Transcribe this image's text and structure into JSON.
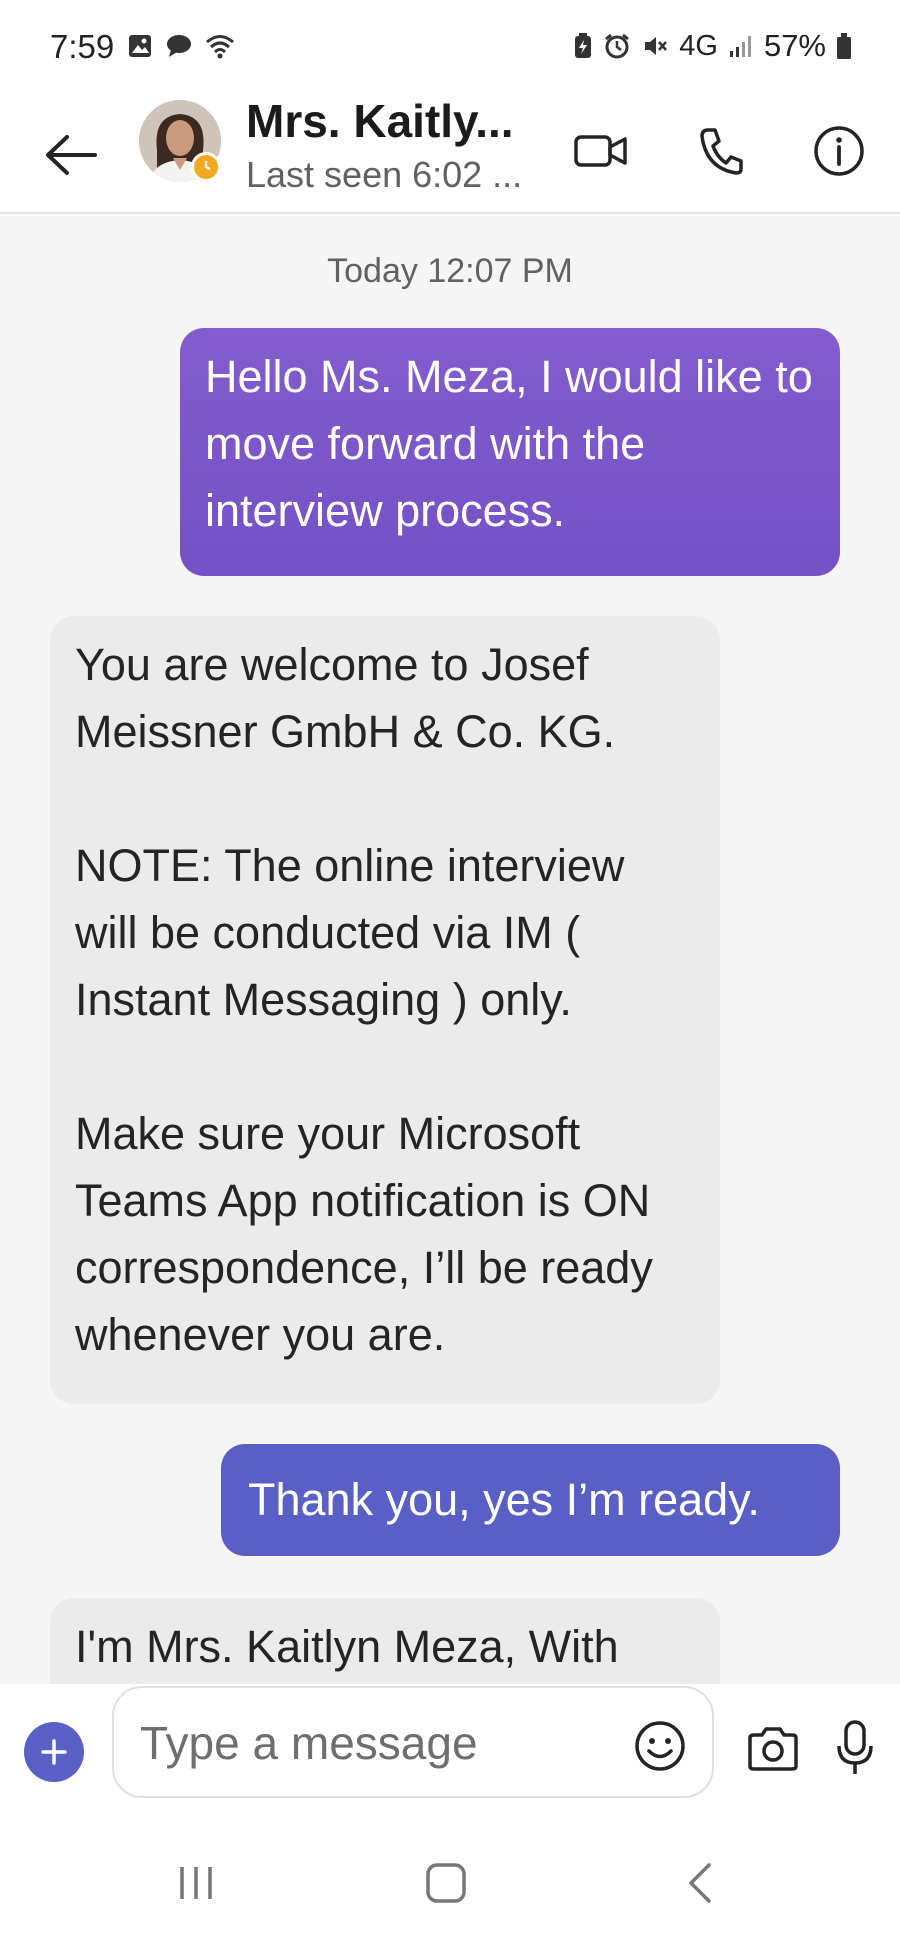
{
  "status_bar": {
    "time": "7:59",
    "network": "4G",
    "battery": "57%"
  },
  "header": {
    "contact_name": "Mrs. Kaitly...",
    "contact_status": "Last seen 6:02 ...",
    "presence_color": "#f2a91f"
  },
  "chat": {
    "date_label": "Today 12:07 PM",
    "messages": [
      {
        "direction": "outgoing",
        "text": "Hello Ms. Meza, I would like to move forward with the interview process."
      },
      {
        "direction": "incoming",
        "text": "You are welcome to Josef Meissner GmbH & Co. KG.\n\nNOTE: The online interview will be conducted via IM ( Instant Messaging ) only.\n\nMake sure your Microsoft Teams App notification is ON correspondence, I’ll be ready whenever you are."
      },
      {
        "direction": "outgoing",
        "text": "Thank you, yes I’m ready."
      },
      {
        "direction": "incoming",
        "text": "I'm Mrs. Kaitlyn Meza, With"
      }
    ]
  },
  "compose": {
    "placeholder": "Type a message"
  },
  "colors": {
    "accent": "#5a5fc6",
    "outgoing_bubble": "#7b55c9",
    "incoming_bubble": "#ebebeb",
    "chat_background": "#f5f5f5"
  },
  "icons": {
    "back": "arrow-left-icon",
    "video": "video-camera-icon",
    "call": "phone-icon",
    "info": "info-icon",
    "plus": "plus-icon",
    "emoji": "emoji-icon",
    "camera": "camera-icon",
    "mic": "microphone-icon"
  }
}
